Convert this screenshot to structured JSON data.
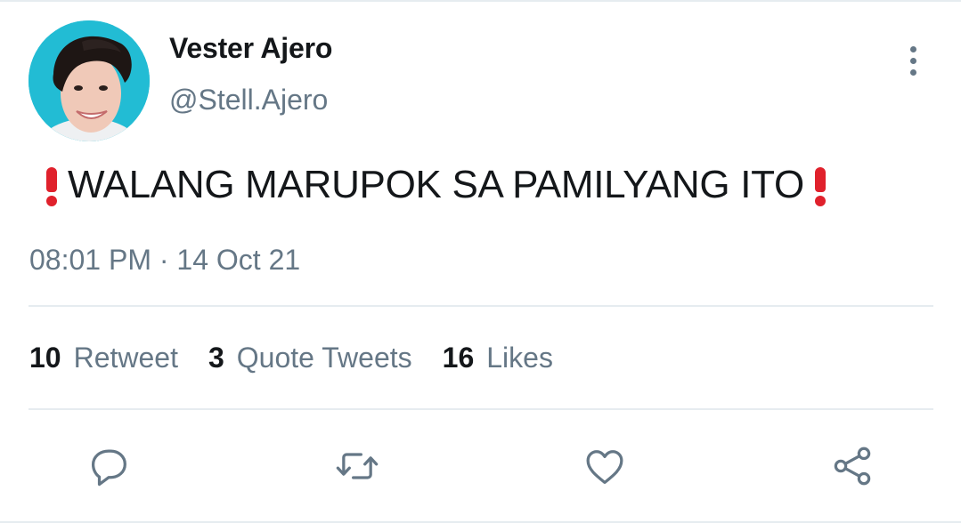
{
  "tweet": {
    "display_name": "Vester Ajero",
    "handle": "@Stell.Ajero",
    "text": "WALANG MARUPOK SA PAMILYANG ITO",
    "timestamp": "08:01 PM · 14 Oct 21"
  },
  "stats": {
    "retweets_count": "10",
    "retweets_label": "Retweet",
    "quotes_count": "3",
    "quotes_label": "Quote Tweets",
    "likes_count": "16",
    "likes_label": "Likes"
  },
  "icons": {
    "more": "more-vertical-icon",
    "reply": "reply-icon",
    "retweet": "retweet-icon",
    "like": "heart-icon",
    "share": "share-icon",
    "emphasis": "exclamation-mark-emoji"
  },
  "colors": {
    "text_primary": "#14171a",
    "text_secondary": "#657786",
    "divider": "#e6ecf0",
    "emoji_red": "#e0212c",
    "avatar_background": "#1fb4ce"
  }
}
